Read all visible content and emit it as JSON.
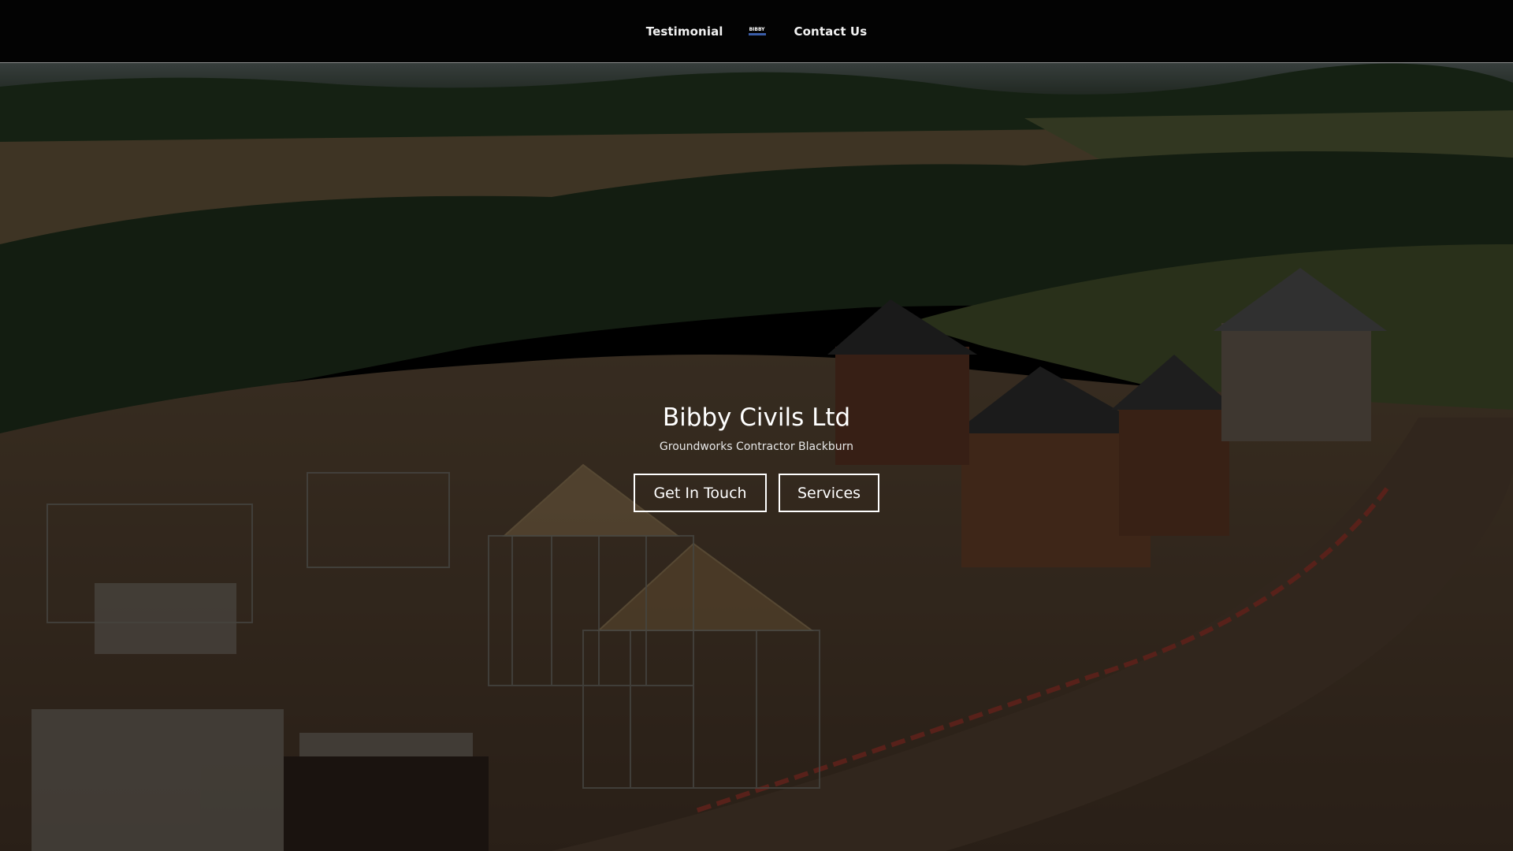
{
  "nav": {
    "left_link": "Testimonial",
    "logo_text": "BIBBY",
    "right_link": "Contact Us"
  },
  "hero": {
    "title": "Bibby Civils Ltd",
    "subtitle": "Groundworks Contractor Blackburn",
    "primary_button": "Get In Touch",
    "secondary_button": "Services",
    "background_image": "aerial-construction-site-photo"
  },
  "colors": {
    "nav_background": "#030303",
    "nav_text": "#f2f2f2",
    "hero_text": "#ffffff",
    "logo_accent": "#3a5da8"
  }
}
